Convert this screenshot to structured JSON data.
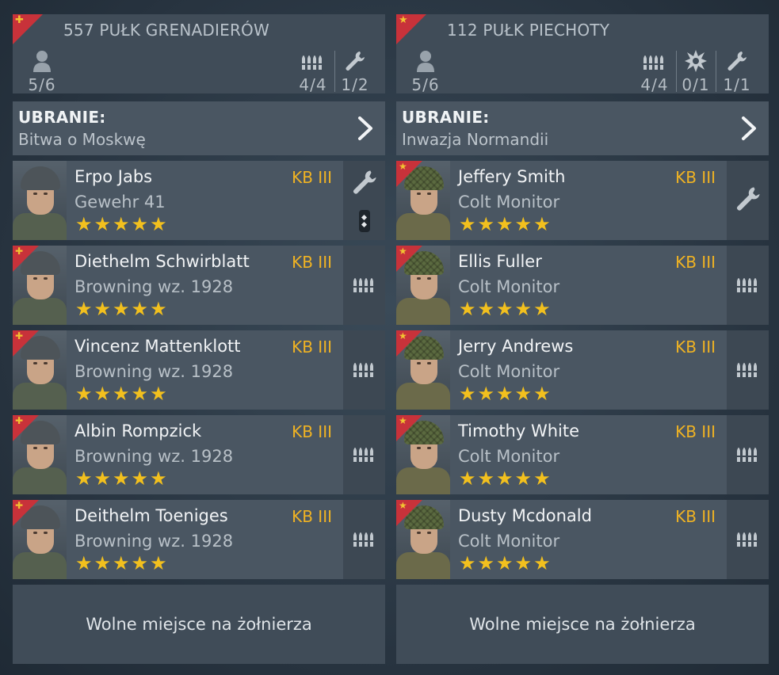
{
  "squads": [
    {
      "title": "557 PUŁK GRENADIERÓW",
      "emblem_glyph": "✚",
      "faction": "german",
      "stats": {
        "soldiers": "5/6",
        "ammo": "4/4",
        "engineer": "1/2"
      },
      "outfit": {
        "label": "UBRANIE:",
        "value": "Bitwa o Moskwę"
      },
      "soldiers": [
        {
          "name": "Erpo Jabs",
          "weapon": "Gewehr 41",
          "rank": "KB III",
          "stars": 5,
          "role_icon": "wrench-icon",
          "leader": true
        },
        {
          "name": "Diethelm Schwirblatt",
          "weapon": "Browning wz. 1928",
          "rank": "KB III",
          "stars": 5,
          "role_icon": "ammo-icon"
        },
        {
          "name": "Vincenz Mattenklott",
          "weapon": "Browning wz. 1928",
          "rank": "KB III",
          "stars": 5,
          "role_icon": "ammo-icon"
        },
        {
          "name": "Albin Rompzick",
          "weapon": "Browning wz. 1928",
          "rank": "KB III",
          "stars": 5,
          "role_icon": "ammo-icon"
        },
        {
          "name": "Deithelm Toeniges",
          "weapon": "Browning wz. 1928",
          "rank": "KB III",
          "stars": 5,
          "role_icon": "ammo-icon"
        }
      ],
      "free_slot_label": "Wolne miejsce na żołnierza"
    },
    {
      "title": "112 PUŁK PIECHOTY",
      "emblem_glyph": "★",
      "faction": "allied",
      "stats": {
        "soldiers": "5/6",
        "ammo": "4/4",
        "explosive": "0/1",
        "engineer": "1/1"
      },
      "outfit": {
        "label": "UBRANIE:",
        "value": "Inwazja Normandii"
      },
      "soldiers": [
        {
          "name": "Jeffery Smith",
          "weapon": "Colt Monitor",
          "rank": "KB III",
          "stars": 5,
          "role_icon": "wrench-icon"
        },
        {
          "name": "Ellis Fuller",
          "weapon": "Colt Monitor",
          "rank": "KB III",
          "stars": 5,
          "role_icon": "ammo-icon"
        },
        {
          "name": "Jerry Andrews",
          "weapon": "Colt Monitor",
          "rank": "KB III",
          "stars": 5,
          "role_icon": "ammo-icon"
        },
        {
          "name": "Timothy White",
          "weapon": "Colt Monitor",
          "rank": "KB III",
          "stars": 5,
          "role_icon": "ammo-icon"
        },
        {
          "name": "Dusty Mcdonald",
          "weapon": "Colt Monitor",
          "rank": "KB III",
          "stars": 5,
          "role_icon": "ammo-icon"
        }
      ],
      "free_slot_label": "Wolne miejsce na żołnierza"
    }
  ],
  "colors": {
    "rank": "#f0b323",
    "star": "#f2c01e",
    "emblem": "#c8323a",
    "panel": "#4a5662"
  }
}
